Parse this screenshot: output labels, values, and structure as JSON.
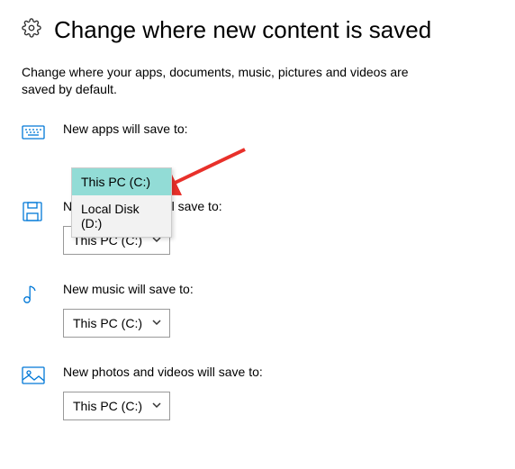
{
  "header": {
    "title": "Change where new content is saved"
  },
  "description": "Change where your apps, documents, music, pictures and videos are saved by default.",
  "sections": {
    "apps": {
      "label": "New apps will save to:",
      "selected": "This PC (C:)",
      "options": [
        "This PC (C:)",
        "Local Disk (D:)"
      ]
    },
    "documents": {
      "label": "New documents will save to:",
      "selected": "This PC (C:)"
    },
    "music": {
      "label": "New music will save to:",
      "selected": "This PC (C:)"
    },
    "photos": {
      "label": "New photos and videos will save to:",
      "selected": "This PC (C:)"
    }
  }
}
